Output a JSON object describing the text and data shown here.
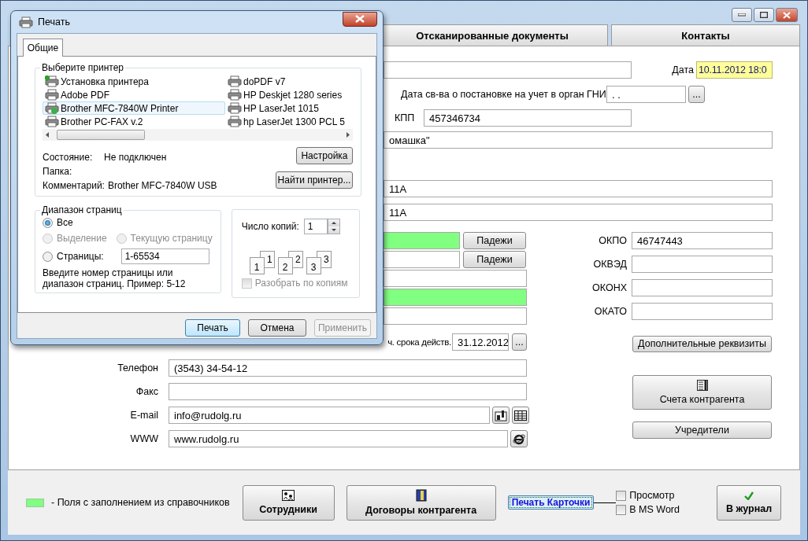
{
  "tabs": [
    {
      "label": "Отсканированные документы",
      "selected": false
    },
    {
      "label": "Контакты",
      "selected": false
    }
  ],
  "form": {
    "date": {
      "label": "Дата",
      "value": "10.11.2012 18:0",
      "highlight": true
    },
    "gni_date": {
      "label": "Дата св-ва о постановке на учет в орган ГНИ",
      "value": ". .",
      "button": "..."
    },
    "kpp": {
      "label": "КПП",
      "value": "457346734"
    },
    "name_value": "омашка\"",
    "address_fields": [
      {
        "value": "11А"
      },
      {
        "value": "11А"
      }
    ],
    "left_fields": [
      {
        "kind": "cases",
        "lookup": true,
        "button": "Падежи"
      },
      {
        "kind": "cases",
        "lookup": false,
        "button": "Падежи"
      },
      {
        "kind": "plain",
        "lookup": false
      },
      {
        "kind": "plain",
        "lookup": true
      },
      {
        "kind": "plain",
        "lookup": false
      },
      {
        "kind": "date",
        "lookup": false,
        "label": "ч. срока действ.",
        "value": "31.12.2012",
        "button": "..."
      }
    ],
    "contacts": [
      {
        "kind": "plain",
        "label": "Телефон",
        "value": "(3543) 34-54-12"
      },
      {
        "kind": "plain",
        "label": "Факс"
      },
      {
        "kind": "email",
        "label": "E-mail",
        "value": "info@rudolg.ru"
      },
      {
        "kind": "web",
        "label": "WWW",
        "value": "www.rudolg.ru"
      }
    ],
    "codes": [
      {
        "label": "ОКПО",
        "value": "46747443"
      },
      {
        "label": "ОКВЭД"
      },
      {
        "label": "ОКОНХ"
      },
      {
        "label": "ОКАТО"
      }
    ],
    "extra_button": "Дополнительные реквизиты",
    "accounts_button": "Счета контрагента",
    "founders_button": "Учредители"
  },
  "footer": {
    "legend": "-  Поля с заполнением из справочников",
    "buttons": [
      {
        "kind": "staff",
        "label": "Сотрудники"
      },
      {
        "kind": "contracts",
        "label": "Договоры контрагента"
      }
    ],
    "print_card": "Печать Карточки",
    "options": [
      {
        "label": "Просмотр",
        "checked": false
      },
      {
        "label": "В MS Word",
        "checked": false
      }
    ],
    "journal": "В журнал"
  },
  "print_dialog": {
    "title": "Печать",
    "tabs": [
      {
        "label": "Общие",
        "selected": true
      }
    ],
    "printer_group": "Выберите принтер",
    "printers": [
      {
        "name": "Установка принтера",
        "kind": "add",
        "selected": false
      },
      {
        "name": "Adobe PDF",
        "kind": "printer",
        "selected": false
      },
      {
        "name": "Brother MFC-7840W Printer",
        "kind": "default",
        "selected": true
      },
      {
        "name": "Brother PC-FAX v.2",
        "kind": "printer",
        "selected": false
      },
      {
        "name": "doPDF v7",
        "kind": "printer",
        "selected": false
      },
      {
        "name": "HP Deskjet 1280 series",
        "kind": "printer",
        "selected": false
      },
      {
        "name": "HP LaserJet 1015",
        "kind": "printer",
        "selected": false
      },
      {
        "name": "hp LaserJet 1300 PCL 5",
        "kind": "printer",
        "selected": false
      }
    ],
    "status": [
      {
        "label": "Состояние:",
        "value": "Не подключен"
      },
      {
        "label": "Папка:"
      },
      {
        "label": "Комментарий:",
        "value": "Brother MFC-7840W USB"
      }
    ],
    "setup_button": "Настройка",
    "find_button": "Найти принтер...",
    "range": {
      "title": "Диапазон страниц",
      "options": [
        {
          "label": "Все",
          "selected": true,
          "disabled": false
        },
        {
          "label": "Выделение",
          "selected": false,
          "disabled": true
        },
        {
          "label": "Текущую страницу",
          "selected": false,
          "disabled": true
        },
        {
          "label": "Страницы:",
          "selected": false,
          "disabled": false
        }
      ],
      "pages_value": "1-65534",
      "hint": "Введите номер страницы или диапазон страниц.  Пример: 5-12"
    },
    "copies": {
      "label": "Число копий:",
      "value": "1",
      "pages": [
        {
          "back": "1",
          "front": "1"
        },
        {
          "back": "2",
          "front": "2"
        },
        {
          "back": "3",
          "front": "3"
        }
      ],
      "collate": {
        "label": "Разобрать по копиям",
        "checked": false,
        "disabled": true
      }
    },
    "buttons": [
      {
        "label": "Печать",
        "default": true,
        "disabled": false
      },
      {
        "label": "Отмена",
        "default": false,
        "disabled": false
      },
      {
        "label": "Применить",
        "default": false,
        "disabled": true
      }
    ]
  }
}
